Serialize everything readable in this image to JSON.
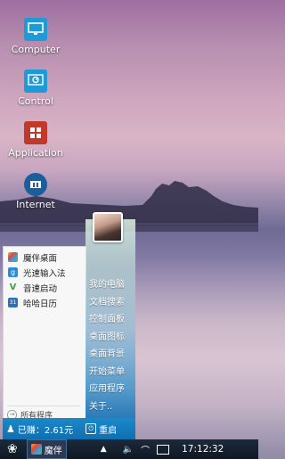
{
  "desktop": {
    "icons": [
      {
        "label": "Computer",
        "icon": "monitor-icon"
      },
      {
        "label": "Control",
        "icon": "control-panel-icon"
      },
      {
        "label": "Application",
        "icon": "apps-grid-icon"
      },
      {
        "label": "Internet",
        "icon": "browser-icon"
      }
    ]
  },
  "start_menu": {
    "pinned": [
      {
        "label": "魔伴桌面",
        "icon": "mobo-desktop-icon",
        "color": "#e8a23a"
      },
      {
        "label": "光速输入法",
        "icon": "input-method-icon",
        "color": "#2d8bd6"
      },
      {
        "label": "音速启动",
        "icon": "vstart-icon",
        "color": "#3fa34d"
      },
      {
        "label": "哈哈日历",
        "icon": "calendar-icon",
        "color": "#2f6fb3"
      }
    ],
    "all_programs": "所有程序",
    "links": [
      "我的电脑",
      "文档搜索",
      "控制面板",
      "桌面图标",
      "桌面背景",
      "开始菜单",
      "应用程序",
      "关于.."
    ],
    "earnings": "已赚：2.61元",
    "restart": "重启"
  },
  "taskbar": {
    "app_label": "魔伴",
    "clock": "17:12:32"
  }
}
